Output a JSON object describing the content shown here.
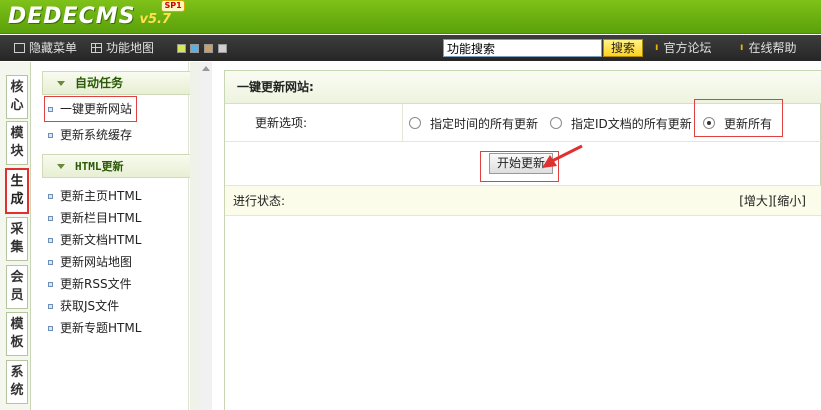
{
  "header": {
    "logo_text": "DEDECMS",
    "version": "v5.7",
    "edition": "SP1"
  },
  "toolbar": {
    "hide_menu": "隐藏菜单",
    "function_map": "功能地图",
    "search_value": "功能搜索",
    "search_button": "搜索",
    "forum_link": "官方论坛",
    "help_link": "在线帮助",
    "swatches": [
      "#d6e85a",
      "#5ab0e6",
      "#c9a06a",
      "#cfcfcf"
    ]
  },
  "tabs": [
    {
      "label": "核心"
    },
    {
      "label": "模块"
    },
    {
      "label": "生成",
      "active": true
    },
    {
      "label": "采集"
    },
    {
      "label": "会员"
    },
    {
      "label": "模板"
    },
    {
      "label": "系统"
    }
  ],
  "sidebar": {
    "sections": [
      {
        "title": "自动任务",
        "items": [
          "一键更新网站",
          "更新系统缓存"
        ]
      },
      {
        "title": "HTML更新",
        "items": [
          "更新主页HTML",
          "更新栏目HTML",
          "更新文档HTML",
          "更新网站地图",
          "更新RSS文件",
          "获取JS文件",
          "更新专题HTML"
        ]
      }
    ]
  },
  "main": {
    "title": "一键更新网站:",
    "option_label": "更新选项:",
    "options": [
      {
        "label": "指定时间的所有更新",
        "selected": false
      },
      {
        "label": "指定ID文档的所有更新",
        "selected": false
      },
      {
        "label": "更新所有",
        "selected": true
      }
    ],
    "start_button": "开始更新",
    "status_label": "进行状态:",
    "enlarge": "[增大]",
    "shrink": "[缩小]"
  },
  "colors": {
    "brand_green": "#6cb212",
    "highlight_red": "#e04040"
  }
}
